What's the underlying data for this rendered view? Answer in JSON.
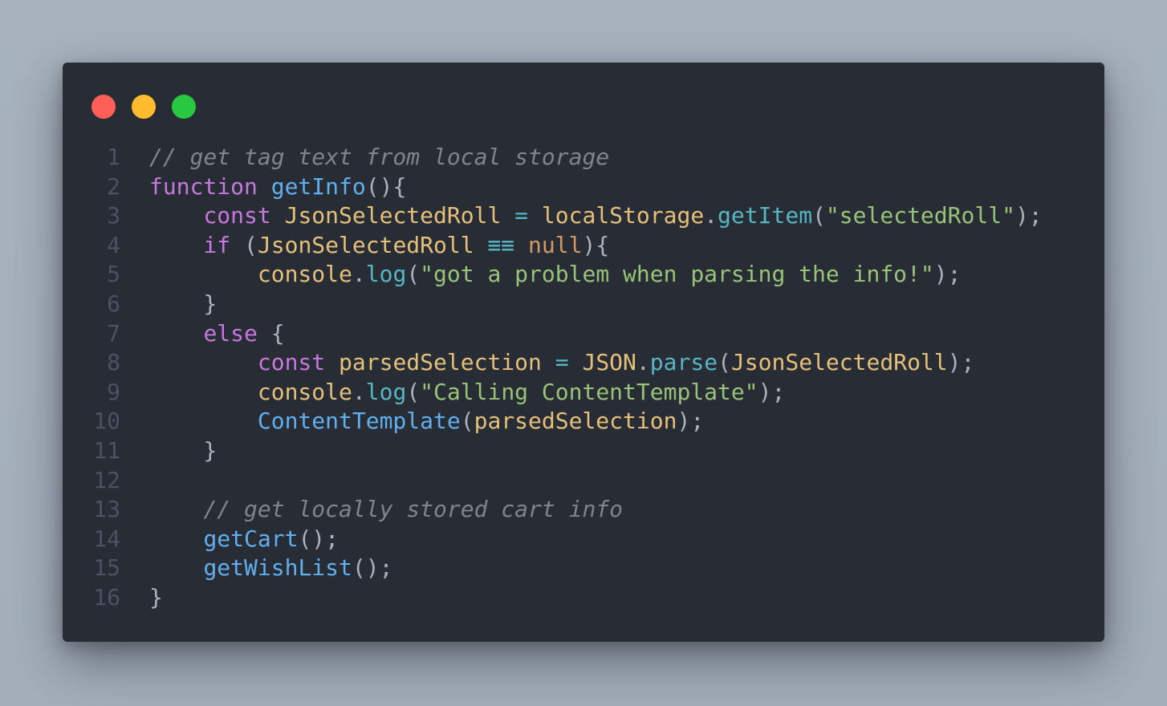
{
  "window": {
    "traffic_lights": [
      {
        "name": "close",
        "color": "#ff5f57"
      },
      {
        "name": "minimize",
        "color": "#febc2e"
      },
      {
        "name": "maximize",
        "color": "#28c840"
      }
    ]
  },
  "code": {
    "language": "javascript",
    "lines": [
      {
        "number": "1",
        "tokens": [
          {
            "t": "comment",
            "v": "// get tag text from local storage"
          }
        ]
      },
      {
        "number": "2",
        "tokens": [
          {
            "t": "keyword",
            "v": "function"
          },
          {
            "t": "plain",
            "v": " "
          },
          {
            "t": "func",
            "v": "getInfo"
          },
          {
            "t": "punct",
            "v": "(){"
          }
        ]
      },
      {
        "number": "3",
        "tokens": [
          {
            "t": "plain",
            "v": "    "
          },
          {
            "t": "keyword",
            "v": "const"
          },
          {
            "t": "plain",
            "v": " "
          },
          {
            "t": "var",
            "v": "JsonSelectedRoll"
          },
          {
            "t": "plain",
            "v": " "
          },
          {
            "t": "op",
            "v": "="
          },
          {
            "t": "plain",
            "v": " "
          },
          {
            "t": "var",
            "v": "localStorage"
          },
          {
            "t": "punct",
            "v": "."
          },
          {
            "t": "method",
            "v": "getItem"
          },
          {
            "t": "punct",
            "v": "("
          },
          {
            "t": "str",
            "v": "\"selectedRoll\""
          },
          {
            "t": "punct",
            "v": ");"
          }
        ]
      },
      {
        "number": "4",
        "tokens": [
          {
            "t": "plain",
            "v": "    "
          },
          {
            "t": "keyword",
            "v": "if"
          },
          {
            "t": "plain",
            "v": " "
          },
          {
            "t": "punct",
            "v": "("
          },
          {
            "t": "var",
            "v": "JsonSelectedRoll"
          },
          {
            "t": "plain",
            "v": " "
          },
          {
            "t": "op",
            "v": "≡≡"
          },
          {
            "t": "plain",
            "v": " "
          },
          {
            "t": "null",
            "v": "null"
          },
          {
            "t": "punct",
            "v": "){"
          }
        ]
      },
      {
        "number": "5",
        "tokens": [
          {
            "t": "plain",
            "v": "        "
          },
          {
            "t": "var",
            "v": "console"
          },
          {
            "t": "punct",
            "v": "."
          },
          {
            "t": "method",
            "v": "log"
          },
          {
            "t": "punct",
            "v": "("
          },
          {
            "t": "str",
            "v": "\"got a problem when parsing the info!\""
          },
          {
            "t": "punct",
            "v": ");"
          }
        ]
      },
      {
        "number": "6",
        "tokens": [
          {
            "t": "plain",
            "v": "    "
          },
          {
            "t": "punct",
            "v": "}"
          }
        ]
      },
      {
        "number": "7",
        "tokens": [
          {
            "t": "plain",
            "v": "    "
          },
          {
            "t": "keyword",
            "v": "else"
          },
          {
            "t": "plain",
            "v": " "
          },
          {
            "t": "punct",
            "v": "{"
          }
        ]
      },
      {
        "number": "8",
        "tokens": [
          {
            "t": "plain",
            "v": "        "
          },
          {
            "t": "keyword",
            "v": "const"
          },
          {
            "t": "plain",
            "v": " "
          },
          {
            "t": "var",
            "v": "parsedSelection"
          },
          {
            "t": "plain",
            "v": " "
          },
          {
            "t": "op",
            "v": "="
          },
          {
            "t": "plain",
            "v": " "
          },
          {
            "t": "var",
            "v": "JSON"
          },
          {
            "t": "punct",
            "v": "."
          },
          {
            "t": "method",
            "v": "parse"
          },
          {
            "t": "punct",
            "v": "("
          },
          {
            "t": "var",
            "v": "JsonSelectedRoll"
          },
          {
            "t": "punct",
            "v": ");"
          }
        ]
      },
      {
        "number": "9",
        "tokens": [
          {
            "t": "plain",
            "v": "        "
          },
          {
            "t": "var",
            "v": "console"
          },
          {
            "t": "punct",
            "v": "."
          },
          {
            "t": "method",
            "v": "log"
          },
          {
            "t": "punct",
            "v": "("
          },
          {
            "t": "str",
            "v": "\"Calling ContentTemplate\""
          },
          {
            "t": "punct",
            "v": ");"
          }
        ]
      },
      {
        "number": "10",
        "tokens": [
          {
            "t": "plain",
            "v": "        "
          },
          {
            "t": "func",
            "v": "ContentTemplate"
          },
          {
            "t": "punct",
            "v": "("
          },
          {
            "t": "var",
            "v": "parsedSelection"
          },
          {
            "t": "punct",
            "v": ");"
          }
        ]
      },
      {
        "number": "11",
        "tokens": [
          {
            "t": "plain",
            "v": "    "
          },
          {
            "t": "punct",
            "v": "}"
          }
        ]
      },
      {
        "number": "12",
        "tokens": []
      },
      {
        "number": "13",
        "tokens": [
          {
            "t": "plain",
            "v": "    "
          },
          {
            "t": "comment",
            "v": "// get locally stored cart info"
          }
        ]
      },
      {
        "number": "14",
        "tokens": [
          {
            "t": "plain",
            "v": "    "
          },
          {
            "t": "func",
            "v": "getCart"
          },
          {
            "t": "punct",
            "v": "();"
          }
        ]
      },
      {
        "number": "15",
        "tokens": [
          {
            "t": "plain",
            "v": "    "
          },
          {
            "t": "func",
            "v": "getWishList"
          },
          {
            "t": "punct",
            "v": "();"
          }
        ]
      },
      {
        "number": "16",
        "tokens": [
          {
            "t": "punct",
            "v": "}"
          }
        ]
      }
    ]
  }
}
